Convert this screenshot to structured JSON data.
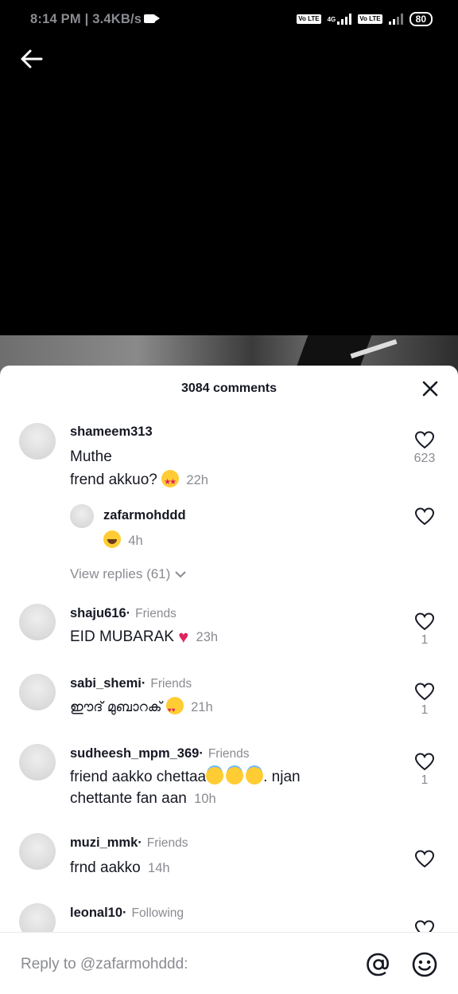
{
  "status_bar": {
    "time": "8:14 PM",
    "sep": "|",
    "speed": "3.4KB/s",
    "net_label": "4G",
    "volte1": "Vo LTE",
    "volte2": "Vo LTE",
    "battery": "80"
  },
  "sheet": {
    "title": "3084 comments"
  },
  "comments": [
    {
      "username": "shameem313",
      "tag": "",
      "line1": "Muthe",
      "line2": "frend akkuo?",
      "emoji": "star-struck",
      "time": "22h",
      "likes": "623"
    },
    {
      "username": "zafarmohddd",
      "emoji": "tears-of-joy",
      "time": "4h"
    },
    {
      "username": "shaju616",
      "sep": "·",
      "tag": "Friends",
      "text": "EID MUBARAK",
      "emoji": "red-heart",
      "heart": "♥",
      "time": "23h",
      "likes": "1"
    },
    {
      "username": "sabi_shemi",
      "sep": "·",
      "tag": "Friends",
      "text": "ഈദ് മുബാറക്",
      "emoji": "heart-eyes",
      "time": "21h",
      "likes": "1"
    },
    {
      "username": "sudheesh_mpm_369",
      "sep": "·",
      "tag": "Friends",
      "line1": "friend aakko chettaa",
      "emoji": "halo",
      "line1_after": ". njan",
      "line2": "chettante fan aan",
      "time": "10h",
      "likes": "1"
    },
    {
      "username": "muzi_mmk",
      "sep": "·",
      "tag": "Friends",
      "text": "frnd aakko",
      "time": "14h"
    },
    {
      "username": "leonal10",
      "sep": "·",
      "tag": "Following",
      "text": "♥♥♥"
    }
  ],
  "view_replies": "View replies (61)",
  "reply": {
    "placeholder": "Reply to @zafarmohddd:"
  },
  "icons": {
    "back": "arrow-left-icon",
    "close": "close-icon",
    "like": "heart-outline-icon",
    "at": "at-sign-icon",
    "emoji": "smiley-icon"
  }
}
